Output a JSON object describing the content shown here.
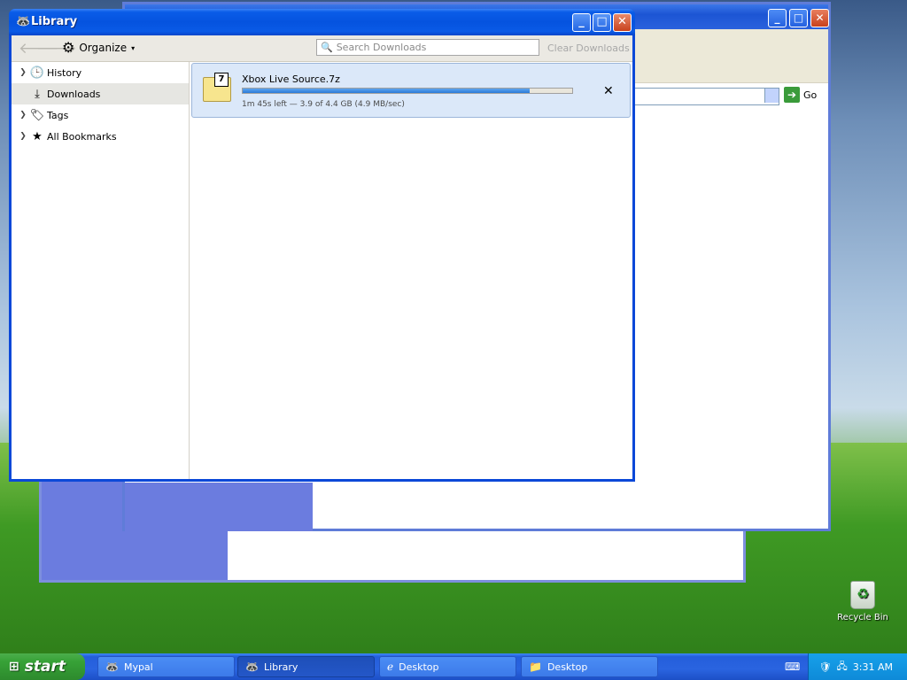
{
  "library": {
    "title": "Library",
    "toolbar": {
      "organize_label": "Organize",
      "search_placeholder": "Search Downloads",
      "clear_label": "Clear Downloads"
    },
    "sidebar": {
      "items": [
        {
          "label": "History",
          "icon": "clock-icon"
        },
        {
          "label": "Downloads",
          "icon": "download-arrow-icon",
          "selected": true
        },
        {
          "label": "Tags",
          "icon": "tag-icon"
        },
        {
          "label": "All Bookmarks",
          "icon": "star-icon"
        }
      ]
    },
    "download": {
      "filename": "Xbox Live Source.7z",
      "status": "1m 45s left — 3.9 of 4.4 GB (4.9 MB/sec)",
      "progress_fraction": 0.87,
      "cancel_glyph": "✕"
    }
  },
  "background_window": {
    "go_label": "Go"
  },
  "desktop": {
    "recycle_bin_label": "Recycle Bin"
  },
  "taskbar": {
    "start_label": "start",
    "tasks": [
      {
        "label": "Mypal",
        "icon": "mypal-icon"
      },
      {
        "label": "Library",
        "icon": "mypal-icon",
        "active": true
      },
      {
        "label": "Desktop",
        "icon": "ie-icon"
      },
      {
        "label": "Desktop",
        "icon": "folder-icon"
      }
    ],
    "clock": "3:31 AM"
  },
  "colors": {
    "xp_blue": "#0a46d6",
    "progress_blue": "#2a7ad8",
    "start_green": "#37a237"
  }
}
